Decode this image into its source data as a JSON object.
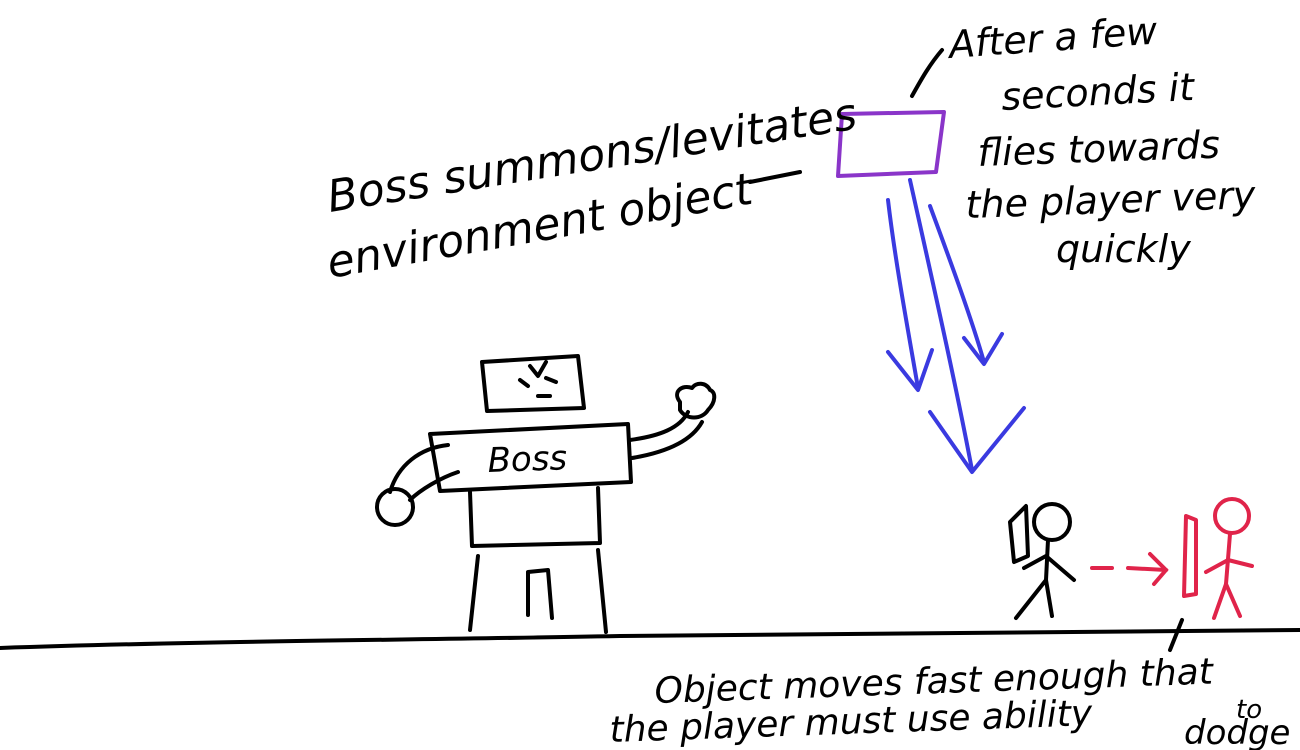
{
  "colors": {
    "ink": "#000000",
    "object": "#8a35c9",
    "trajectory": "#3a3ae0",
    "dodge": "#e0244a"
  },
  "annotations": {
    "boss_summons_line1": "Boss summons/levitates",
    "boss_summons_line2": "environment object",
    "after_line1": "After a few",
    "after_line2": "seconds it",
    "after_line3": "flies towards",
    "after_line4": "the player very",
    "after_line5": "quickly",
    "object_moves_line1": "Object moves fast enough that",
    "object_moves_line2": "the player must use ability",
    "object_moves_to": "to",
    "object_moves_dodge": "dodge"
  },
  "boss": {
    "chest_label": "Boss"
  }
}
